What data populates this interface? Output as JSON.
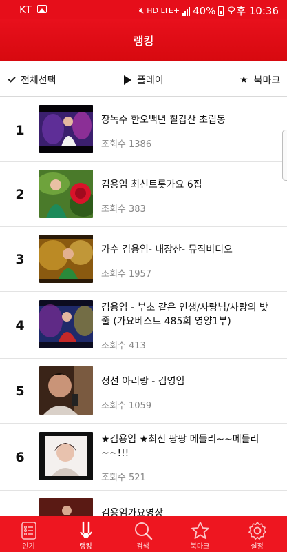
{
  "status_bar": {
    "carrier": "KT",
    "indicators": "HD LTE+",
    "battery": "40%",
    "time": "오후 10:36"
  },
  "app_bar": {
    "title": "랭킹"
  },
  "toolbar": {
    "select_all": "전체선택",
    "play": "플레이",
    "bookmark": "북마크"
  },
  "list": {
    "views_label": "조회수",
    "items": [
      {
        "rank": "1",
        "title": "장녹수 한오백년 칠갑산 초립동",
        "views": "조회수 1386"
      },
      {
        "rank": "2",
        "title": "김용임 최신트롯가요 6집",
        "views": "조회수 383"
      },
      {
        "rank": "3",
        "title": "가수 김용임- 내장산- 뮤직비디오",
        "views": "조회수 1957"
      },
      {
        "rank": "4",
        "title": "김용임 - 부초 같은 인생/사랑님/사랑의 밧줄 (가요베스트 485회 영양1부)",
        "views": "조회수 413"
      },
      {
        "rank": "5",
        "title": "정선 아리랑 - 김영임",
        "views": "조회수 1059"
      },
      {
        "rank": "6",
        "title": "★김용임 ★최신 팡팡 메들리~~메들리~~!!!",
        "views": "조회수 521"
      },
      {
        "rank": "",
        "title": "김용임가요영상",
        "views": ""
      }
    ]
  },
  "bottom_nav": [
    {
      "label": "인기",
      "icon": "list-icon"
    },
    {
      "label": "랭킹",
      "icon": "ranking-icon"
    },
    {
      "label": "검색",
      "icon": "search-icon"
    },
    {
      "label": "북마크",
      "icon": "star-icon"
    },
    {
      "label": "설정",
      "icon": "gear-icon"
    }
  ],
  "colors": {
    "brand_red": "#e60e1a",
    "view_gray": "#888888"
  }
}
